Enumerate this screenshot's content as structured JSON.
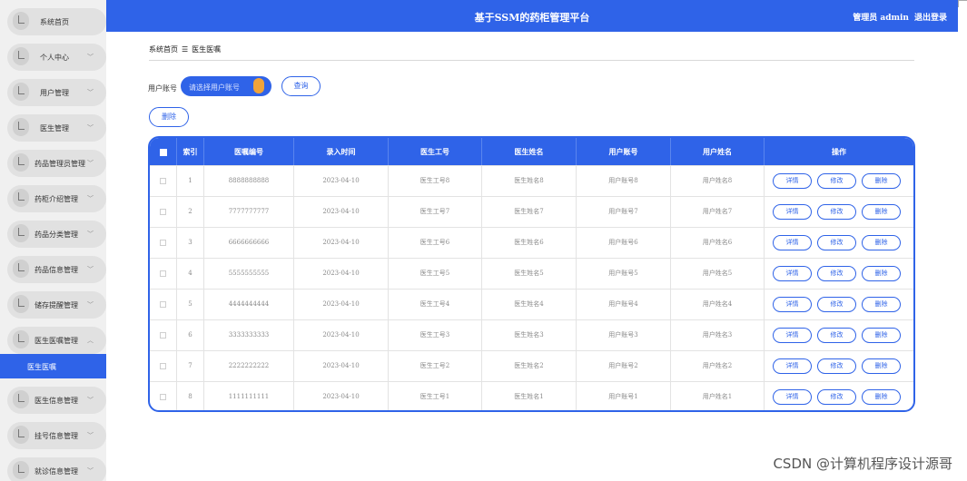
{
  "sidebar": {
    "items": [
      {
        "label": "系统首页",
        "chevron": ""
      },
      {
        "label": "个人中心",
        "chevron": "﹀"
      },
      {
        "label": "用户管理",
        "chevron": "﹀"
      },
      {
        "label": "医生管理",
        "chevron": "﹀"
      },
      {
        "label": "药品管理员管理",
        "chevron": "﹀"
      },
      {
        "label": "药柜介绍管理",
        "chevron": "﹀"
      },
      {
        "label": "药品分类管理",
        "chevron": "﹀"
      },
      {
        "label": "药品信息管理",
        "chevron": "﹀"
      },
      {
        "label": "储存提醒管理",
        "chevron": "﹀"
      },
      {
        "label": "医生医嘱管理",
        "chevron": "︿"
      },
      {
        "label": "医生信息管理",
        "chevron": "﹀"
      },
      {
        "label": "挂号信息管理",
        "chevron": "﹀"
      },
      {
        "label": "就诊信息管理",
        "chevron": "﹀"
      }
    ],
    "active_sub": "医生医嘱"
  },
  "header": {
    "title": "基于SSM的药柜管理平台",
    "user": "管理员 admin",
    "logout": "退出登录"
  },
  "breadcrumb": {
    "home": "系统首页",
    "sep": "☰",
    "current": "医生医嘱"
  },
  "search": {
    "label": "用户账号",
    "placeholder": "请选择用户账号",
    "query_button": "查询",
    "delete_button": "删除"
  },
  "table": {
    "headers": [
      "索引",
      "医嘱编号",
      "录入时间",
      "医生工号",
      "医生姓名",
      "用户账号",
      "用户姓名",
      "操作"
    ],
    "rows": [
      {
        "index": "1",
        "code": "8888888888",
        "time": "2023-04-10",
        "doc_no": "医生工号8",
        "doc_name": "医生姓名8",
        "user_acc": "用户账号8",
        "user_name": "用户姓名8"
      },
      {
        "index": "2",
        "code": "7777777777",
        "time": "2023-04-10",
        "doc_no": "医生工号7",
        "doc_name": "医生姓名7",
        "user_acc": "用户账号7",
        "user_name": "用户姓名7"
      },
      {
        "index": "3",
        "code": "6666666666",
        "time": "2023-04-10",
        "doc_no": "医生工号6",
        "doc_name": "医生姓名6",
        "user_acc": "用户账号6",
        "user_name": "用户姓名6"
      },
      {
        "index": "4",
        "code": "5555555555",
        "time": "2023-04-10",
        "doc_no": "医生工号5",
        "doc_name": "医生姓名5",
        "user_acc": "用户账号5",
        "user_name": "用户姓名5"
      },
      {
        "index": "5",
        "code": "4444444444",
        "time": "2023-04-10",
        "doc_no": "医生工号4",
        "doc_name": "医生姓名4",
        "user_acc": "用户账号4",
        "user_name": "用户姓名4"
      },
      {
        "index": "6",
        "code": "3333333333",
        "time": "2023-04-10",
        "doc_no": "医生工号3",
        "doc_name": "医生姓名3",
        "user_acc": "用户账号3",
        "user_name": "用户姓名3"
      },
      {
        "index": "7",
        "code": "2222222222",
        "time": "2023-04-10",
        "doc_no": "医生工号2",
        "doc_name": "医生姓名2",
        "user_acc": "用户账号2",
        "user_name": "用户姓名2"
      },
      {
        "index": "8",
        "code": "1111111111",
        "time": "2023-04-10",
        "doc_no": "医生工号1",
        "doc_name": "医生姓名1",
        "user_acc": "用户账号1",
        "user_name": "用户姓名1"
      }
    ],
    "actions": {
      "detail": "详情",
      "edit": "修改",
      "delete": "删除"
    }
  },
  "watermark": "CSDN @计算机程序设计源哥",
  "colors": {
    "primary": "#2f63e8",
    "accent": "#f0a33a"
  }
}
